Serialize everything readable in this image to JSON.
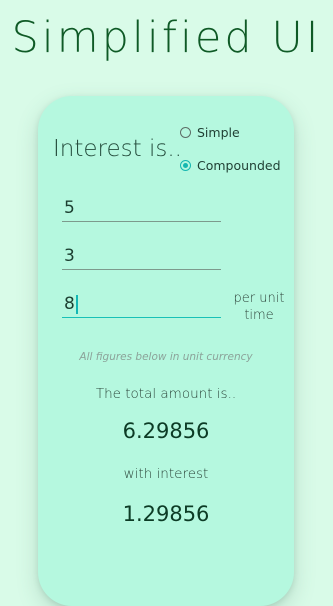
{
  "app": {
    "title": "Simplified UI"
  },
  "interest": {
    "label": "Interest is..",
    "options": [
      {
        "label": "Simple",
        "selected": false
      },
      {
        "label": "Compounded",
        "selected": true
      }
    ]
  },
  "inputs": {
    "field1_value": "5",
    "field2_value": "3",
    "field3_value": "8",
    "field3_suffix": "per unit time"
  },
  "results": {
    "note": "All figures below in unit currency",
    "total_label": "The total amount is..",
    "total_value": "6.29856",
    "interest_label": "with interest",
    "interest_value": "1.29856"
  },
  "colors": {
    "background": "#d9fbe8",
    "card": "#b5f8df",
    "accent": "#16b7b1",
    "title": "#0f5a26"
  }
}
